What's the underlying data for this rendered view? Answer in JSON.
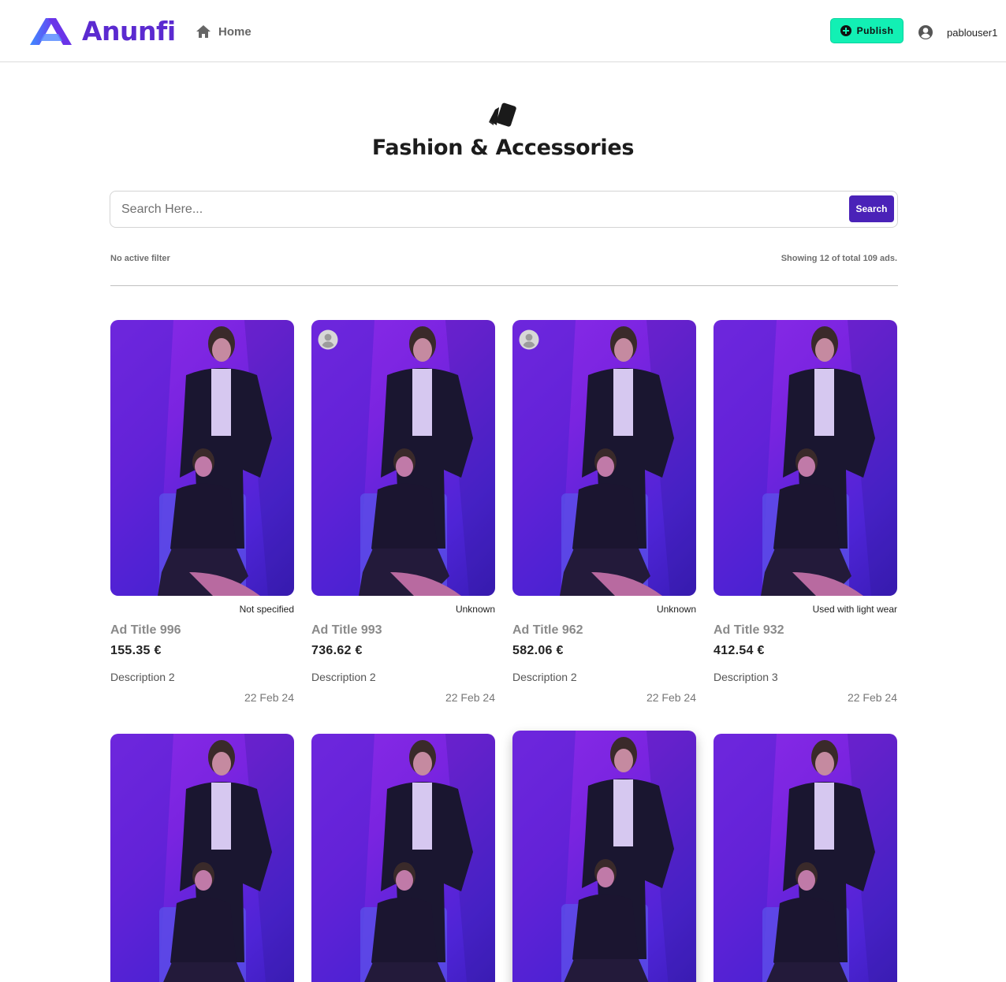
{
  "header": {
    "brand": "Anunfi",
    "nav_home": "Home",
    "publish_label": "Publish",
    "username": "pablouser1"
  },
  "category": {
    "icon": "tag-icon",
    "title": "Fashion & Accessories"
  },
  "search": {
    "placeholder": "Search Here...",
    "button_label": "Search"
  },
  "results": {
    "filter_status": "No active filter",
    "count_text": "Showing 12 of total 109 ads."
  },
  "ads": [
    {
      "title": "Ad Title 996",
      "price": "155.35 €",
      "description": "Description 2",
      "date": "22 Feb 24",
      "condition": "Not specified",
      "avatar": false
    },
    {
      "title": "Ad Title 993",
      "price": "736.62 €",
      "description": "Description 2",
      "date": "22 Feb 24",
      "condition": "Unknown",
      "avatar": true
    },
    {
      "title": "Ad Title 962",
      "price": "582.06 €",
      "description": "Description 2",
      "date": "22 Feb 24",
      "condition": "Unknown",
      "avatar": true
    },
    {
      "title": "Ad Title 932",
      "price": "412.54 €",
      "description": "Description 3",
      "date": "22 Feb 24",
      "condition": "Used with light wear",
      "avatar": false
    },
    {
      "avatar": false
    },
    {
      "avatar": false
    },
    {
      "avatar": false
    },
    {
      "avatar": false
    }
  ],
  "colors": {
    "brand": "#5b2ad0",
    "publish": "#12f0b4",
    "search_button": "#4a22b8"
  }
}
